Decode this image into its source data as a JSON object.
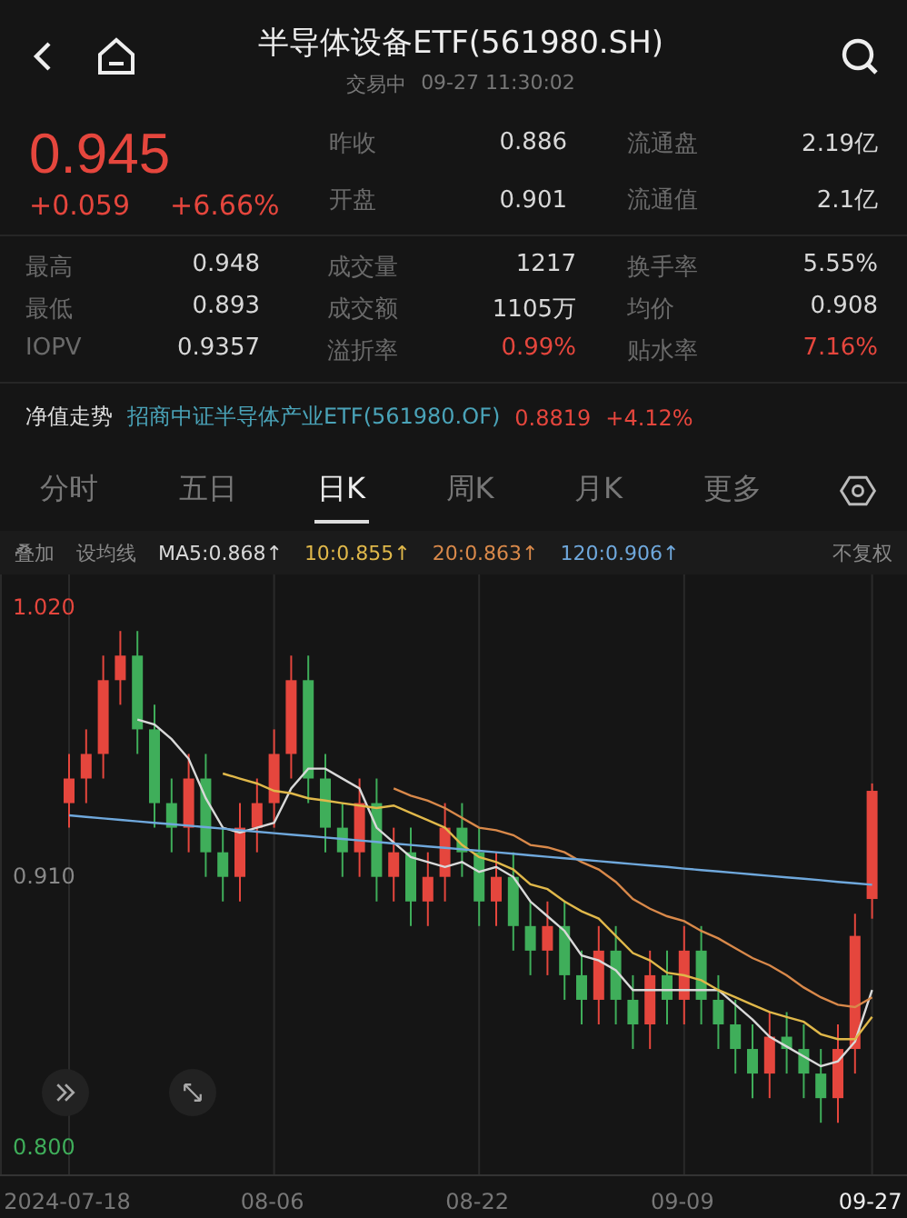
{
  "header": {
    "title": "半导体设备ETF(561980.SH)",
    "status": "交易中",
    "time": "09-27 11:30:02"
  },
  "quote": {
    "price": "0.945",
    "change": "+0.059",
    "change_pct": "+6.66%"
  },
  "quote_stats": [
    {
      "label": "昨收",
      "value": "0.886"
    },
    {
      "label": "流通盘",
      "value": "2.19亿"
    },
    {
      "label": "开盘",
      "value": "0.901"
    },
    {
      "label": "流通值",
      "value": "2.1亿"
    }
  ],
  "stats": [
    {
      "label": "最高",
      "value": "0.948",
      "color": "#d8d8d8"
    },
    {
      "label": "成交量",
      "value": "1217",
      "color": "#d8d8d8"
    },
    {
      "label": "换手率",
      "value": "5.55%",
      "color": "#d8d8d8"
    },
    {
      "label": "最低",
      "value": "0.893",
      "color": "#d8d8d8"
    },
    {
      "label": "成交额",
      "value": "1105万",
      "color": "#d8d8d8"
    },
    {
      "label": "均价",
      "value": "0.908",
      "color": "#d8d8d8"
    },
    {
      "label": "IOPV",
      "value": "0.9357",
      "color": "#d8d8d8"
    },
    {
      "label": "溢折率",
      "value": "0.99%",
      "color": "#e5463d"
    },
    {
      "label": "贴水率",
      "value": "7.16%",
      "color": "#e5463d"
    }
  ],
  "nav": {
    "label": "净值走势",
    "fund": "招商中证半导体产业ETF(561980.OF)",
    "value": "0.8819",
    "change": "+4.12%"
  },
  "tabs": [
    {
      "label": "分时",
      "selected": false
    },
    {
      "label": "五日",
      "selected": false
    },
    {
      "label": "日K",
      "selected": true
    },
    {
      "label": "周K",
      "selected": false
    },
    {
      "label": "月K",
      "selected": false
    },
    {
      "label": "更多",
      "selected": false
    }
  ],
  "legend": {
    "overlay": "叠加",
    "ma_setting": "设均线",
    "readings": [
      ":0.868↑",
      ":0.855↑",
      ":0.863↑",
      ":0.906↑"
    ],
    "adjust": "不复权"
  },
  "chart_data": {
    "type": "candlestick",
    "ylim": [
      0.789,
      1.033
    ],
    "grid": true,
    "yticks": [
      {
        "value": 1.02,
        "label": "1.020"
      },
      {
        "value": 0.91,
        "label": "0.910"
      },
      {
        "value": 0.8,
        "label": "0.800"
      }
    ],
    "categories": [
      "2024-07-18",
      null,
      null,
      null,
      null,
      null,
      null,
      null,
      null,
      null,
      null,
      null,
      "08-06",
      null,
      null,
      null,
      null,
      null,
      null,
      null,
      null,
      null,
      null,
      null,
      "08-22",
      null,
      null,
      null,
      null,
      null,
      null,
      null,
      null,
      null,
      null,
      null,
      "09-09",
      null,
      null,
      null,
      null,
      null,
      null,
      null,
      null,
      null,
      null,
      "09-27"
    ],
    "ohlc": [
      [
        0.94,
        0.96,
        0.93,
        0.95
      ],
      [
        0.95,
        0.97,
        0.94,
        0.96
      ],
      [
        0.96,
        1.0,
        0.95,
        0.99
      ],
      [
        0.99,
        1.01,
        0.98,
        1.0
      ],
      [
        1.0,
        1.01,
        0.96,
        0.97
      ],
      [
        0.97,
        0.98,
        0.93,
        0.94
      ],
      [
        0.94,
        0.95,
        0.92,
        0.93
      ],
      [
        0.93,
        0.96,
        0.92,
        0.95
      ],
      [
        0.95,
        0.96,
        0.91,
        0.92
      ],
      [
        0.92,
        0.93,
        0.9,
        0.91
      ],
      [
        0.91,
        0.94,
        0.9,
        0.93
      ],
      [
        0.93,
        0.95,
        0.92,
        0.94
      ],
      [
        0.94,
        0.97,
        0.93,
        0.96
      ],
      [
        0.96,
        1.0,
        0.95,
        0.99
      ],
      [
        0.99,
        1.0,
        0.94,
        0.95
      ],
      [
        0.95,
        0.96,
        0.92,
        0.93
      ],
      [
        0.93,
        0.94,
        0.91,
        0.92
      ],
      [
        0.92,
        0.95,
        0.91,
        0.94
      ],
      [
        0.94,
        0.95,
        0.9,
        0.91
      ],
      [
        0.91,
        0.93,
        0.9,
        0.92
      ],
      [
        0.92,
        0.93,
        0.89,
        0.9
      ],
      [
        0.9,
        0.92,
        0.89,
        0.91
      ],
      [
        0.91,
        0.94,
        0.9,
        0.93
      ],
      [
        0.93,
        0.94,
        0.91,
        0.92
      ],
      [
        0.92,
        0.93,
        0.89,
        0.9
      ],
      [
        0.9,
        0.92,
        0.89,
        0.91
      ],
      [
        0.91,
        0.92,
        0.88,
        0.89
      ],
      [
        0.89,
        0.9,
        0.87,
        0.88
      ],
      [
        0.88,
        0.9,
        0.87,
        0.89
      ],
      [
        0.89,
        0.9,
        0.86,
        0.87
      ],
      [
        0.87,
        0.88,
        0.85,
        0.86
      ],
      [
        0.86,
        0.89,
        0.85,
        0.88
      ],
      [
        0.88,
        0.89,
        0.85,
        0.86
      ],
      [
        0.86,
        0.87,
        0.84,
        0.85
      ],
      [
        0.85,
        0.88,
        0.84,
        0.87
      ],
      [
        0.87,
        0.88,
        0.85,
        0.86
      ],
      [
        0.86,
        0.89,
        0.85,
        0.88
      ],
      [
        0.88,
        0.89,
        0.85,
        0.86
      ],
      [
        0.86,
        0.87,
        0.84,
        0.85
      ],
      [
        0.85,
        0.86,
        0.83,
        0.84
      ],
      [
        0.84,
        0.85,
        0.82,
        0.83
      ],
      [
        0.83,
        0.855,
        0.82,
        0.845
      ],
      [
        0.845,
        0.855,
        0.83,
        0.84
      ],
      [
        0.84,
        0.85,
        0.82,
        0.83
      ],
      [
        0.83,
        0.84,
        0.81,
        0.82
      ],
      [
        0.82,
        0.85,
        0.81,
        0.84
      ],
      [
        0.84,
        0.895,
        0.83,
        0.886
      ],
      [
        0.901,
        0.948,
        0.893,
        0.945
      ]
    ],
    "series": [
      {
        "name": "MA5",
        "type": "line",
        "color": "#d9d9d9",
        "values": [
          null,
          null,
          null,
          null,
          0.974,
          0.972,
          0.966,
          0.958,
          0.942,
          0.93,
          0.928,
          0.93,
          0.932,
          0.946,
          0.954,
          0.954,
          0.95,
          0.946,
          0.93,
          0.924,
          0.918,
          0.916,
          0.914,
          0.916,
          0.912,
          0.914,
          0.91,
          0.9,
          0.894,
          0.888,
          0.878,
          0.876,
          0.872,
          0.864,
          0.864,
          0.864,
          0.864,
          0.864,
          0.864,
          0.858,
          0.852,
          0.845,
          0.841,
          0.837,
          0.833,
          0.835,
          0.843,
          0.864
        ]
      },
      {
        "name": "10",
        "type": "line",
        "color": "#e0b84a",
        "values": [
          null,
          null,
          null,
          null,
          null,
          null,
          null,
          null,
          null,
          0.952,
          0.95,
          0.948,
          0.945,
          0.944,
          0.942,
          0.941,
          0.94,
          0.939,
          0.938,
          0.939,
          0.936,
          0.933,
          0.93,
          0.923,
          0.918,
          0.916,
          0.913,
          0.907,
          0.905,
          0.9,
          0.896,
          0.893,
          0.886,
          0.879,
          0.876,
          0.871,
          0.87,
          0.868,
          0.864,
          0.861,
          0.858,
          0.855,
          0.853,
          0.851,
          0.846,
          0.844,
          0.844,
          0.853
        ]
      },
      {
        "name": "20",
        "type": "line",
        "color": "#d9894a",
        "values": [
          null,
          null,
          null,
          null,
          null,
          null,
          null,
          null,
          null,
          null,
          null,
          null,
          null,
          null,
          null,
          null,
          null,
          null,
          null,
          0.946,
          0.943,
          0.941,
          0.938,
          0.934,
          0.93,
          0.929,
          0.927,
          0.923,
          0.922,
          0.92,
          0.916,
          0.913,
          0.908,
          0.901,
          0.897,
          0.894,
          0.892,
          0.888,
          0.885,
          0.881,
          0.877,
          0.874,
          0.87,
          0.865,
          0.861,
          0.858,
          0.857,
          0.861
        ]
      },
      {
        "name": "120",
        "type": "line",
        "color": "#6fa8dc",
        "values": [
          0.935,
          0.9344,
          0.9338,
          0.9332,
          0.9326,
          0.932,
          0.9314,
          0.9308,
          0.9302,
          0.9296,
          0.929,
          0.9284,
          0.9278,
          0.9272,
          0.9266,
          0.926,
          0.9254,
          0.9248,
          0.9242,
          0.9236,
          0.923,
          0.9224,
          0.9218,
          0.9212,
          0.9206,
          0.92,
          0.9194,
          0.9188,
          0.9182,
          0.9176,
          0.917,
          0.9164,
          0.9158,
          0.9152,
          0.9146,
          0.914,
          0.9134,
          0.9128,
          0.9122,
          0.9116,
          0.911,
          0.9104,
          0.9098,
          0.9092,
          0.9086,
          0.908,
          0.9074,
          0.9068
        ]
      }
    ]
  }
}
